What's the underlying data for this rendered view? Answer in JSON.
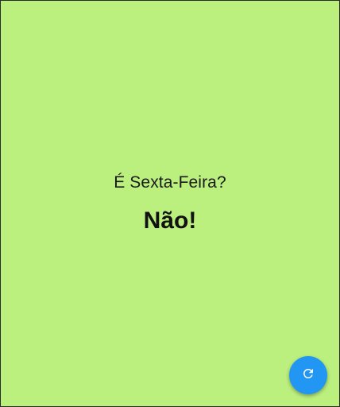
{
  "main": {
    "question": "É Sexta-Feira?",
    "answer": "Não!"
  },
  "fab": {
    "icon": "refresh-icon"
  },
  "colors": {
    "background": "#bbef7e",
    "fab": "#2196f3",
    "fab_icon": "#ffffff"
  }
}
